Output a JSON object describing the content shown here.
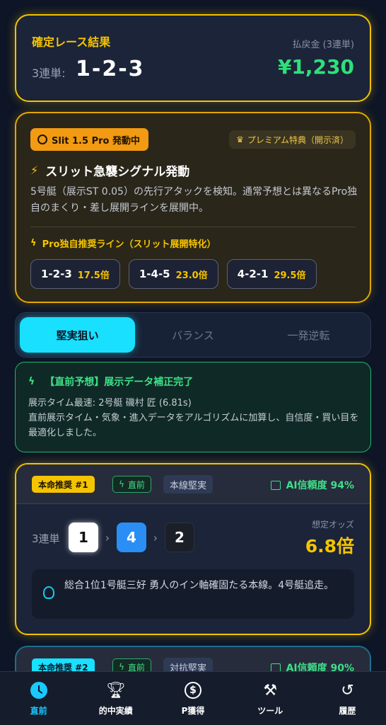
{
  "result": {
    "title": "確定レース結果",
    "label": "3連単:",
    "combo": "1-2-3",
    "payout_label": "払戻金 (3連単)",
    "payout": "¥1,230"
  },
  "pro": {
    "badge": "Slit 1.5 Pro 発動中",
    "premium": "プレミアム特典（開示済）",
    "signal_title": "スリット急襲シグナル発動",
    "signal_desc": "5号艇（展示ST 0.05）の先行アタックを検知。通常予想とは異なるPro独自のまくり・差し展開ラインを展開中。",
    "line_title": "Pro独自推奨ライン（スリット展開特化）",
    "picks": [
      {
        "combo": "1-2-3",
        "odds": "17.5倍"
      },
      {
        "combo": "1-4-5",
        "odds": "23.0倍"
      },
      {
        "combo": "4-2-1",
        "odds": "29.5倍"
      }
    ]
  },
  "tabs": [
    {
      "label": "堅実狙い",
      "active": true
    },
    {
      "label": "バランス",
      "active": false
    },
    {
      "label": "一発逆転",
      "active": false
    }
  ],
  "update": {
    "title": "【直前予想】展示データ補正完了",
    "line1": "展示タイム最速: 2号艇 磯村 匠 (6.81s)",
    "line2": "直前展示タイム・気象・進入データをアルゴリズムに加算し、自信度・買い目を最適化しました。"
  },
  "recs": [
    {
      "tag": "本命推奨 #1",
      "pre": "直前",
      "type": "本線堅実",
      "ai": "AI信頼度 94%",
      "label": "3連単",
      "boats": [
        "1",
        "4",
        "2"
      ],
      "odds_label": "想定オッズ",
      "odds": "6.8倍",
      "comment": "総合1位1号艇三好 勇人のイン軸確固たる本線。4号艇追走。"
    },
    {
      "tag": "本命推奨 #2",
      "pre": "直前",
      "type": "対抗堅実",
      "ai": "AI信頼度 90%"
    }
  ],
  "nav": [
    {
      "label": "直前",
      "icon": "clock-icon"
    },
    {
      "label": "的中実績",
      "icon": "trophy-icon"
    },
    {
      "label": "P獲得",
      "icon": "dollar-icon"
    },
    {
      "label": "ツール",
      "icon": "tools-icon"
    },
    {
      "label": "履歴",
      "icon": "history-icon"
    }
  ],
  "colors": {
    "accent_gold": "#f5c400",
    "accent_cyan": "#19e0ff",
    "accent_green": "#3ee088",
    "background": "#0d1526"
  }
}
